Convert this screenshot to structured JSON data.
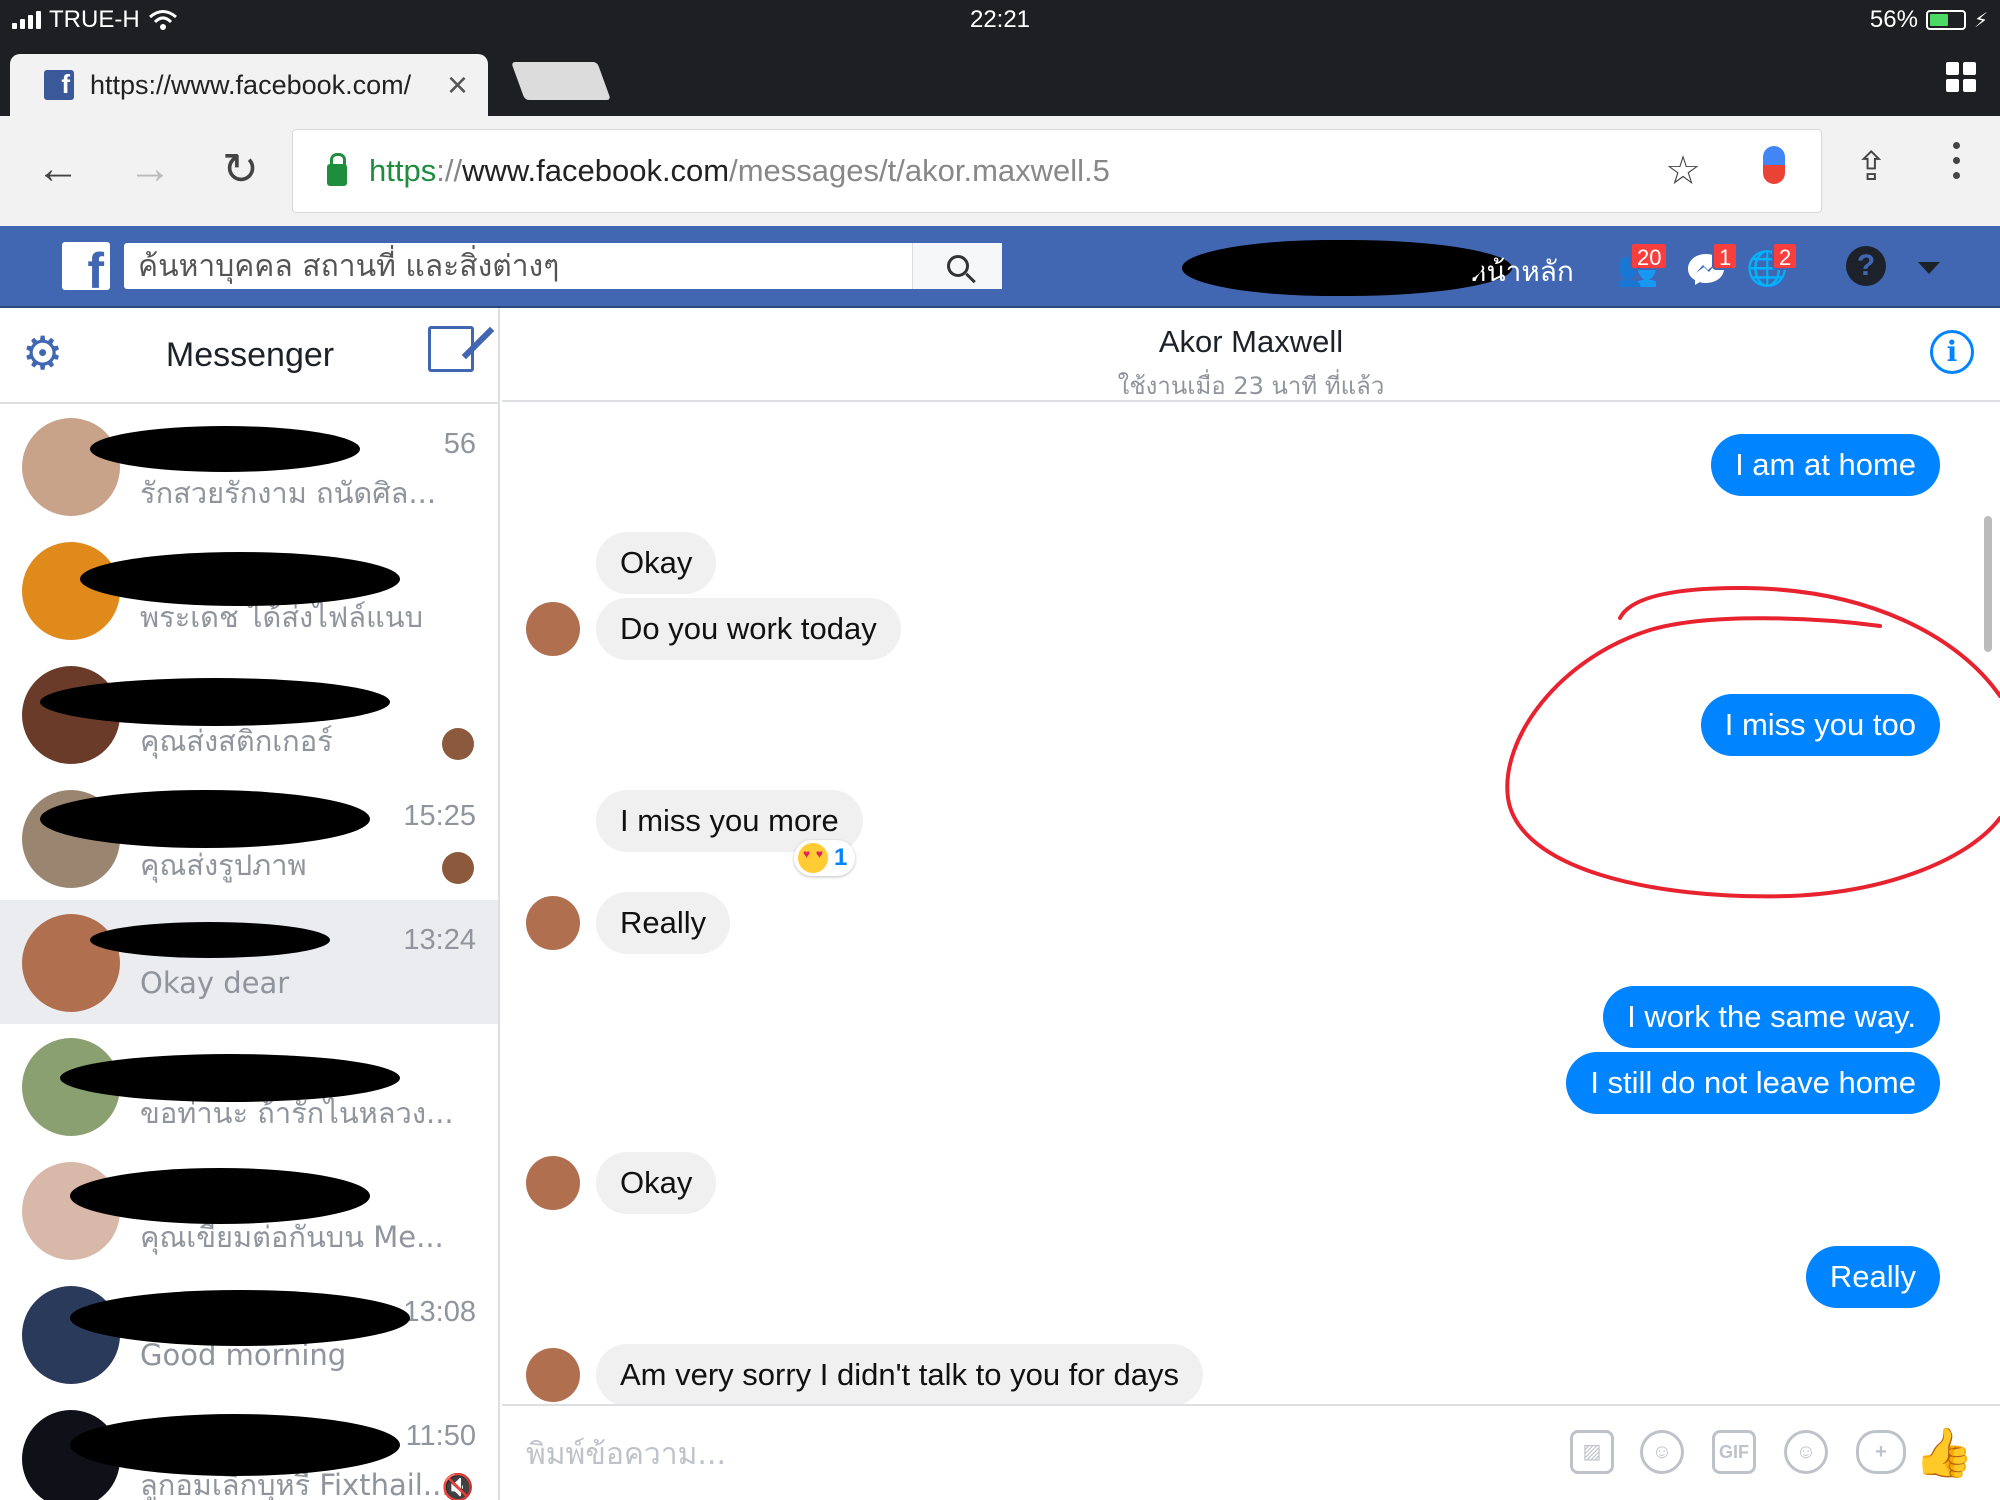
{
  "status_bar": {
    "carrier": "TRUE-H",
    "time": "22:21",
    "battery": "56%",
    "battery_level": 0.56
  },
  "tab": {
    "title": "https://www.facebook.com/",
    "favicon": "facebook-favicon"
  },
  "omnibox": {
    "scheme": "https",
    "sep": "://",
    "host": "www.facebook.com",
    "path": "/messages/t/akor.maxwell.5"
  },
  "fb": {
    "search_placeholder": "ค้นหาบุคคล สถานที่ และสิ่งต่างๆ",
    "home_label": "หน้าหลัก",
    "badges": {
      "friends": "20",
      "messages": "1",
      "notifications": "2"
    },
    "help": "?"
  },
  "sidebar": {
    "title": "Messenger",
    "conversations": [
      {
        "snippet": "รักสวยรักงาม ถนัดศิล...",
        "time": "56",
        "avatar": "#c8a38a"
      },
      {
        "snippet": "พระเดช ได้ส่งไฟล์แนบ",
        "time": "",
        "avatar": "#e08a1c"
      },
      {
        "snippet": "คุณส่งสติกเกอร์",
        "time": "",
        "avatar": "#6b3b2a"
      },
      {
        "snippet": "คุณส่งรูปภาพ",
        "time": "15:25",
        "avatar": "#9a8670"
      },
      {
        "snippet": "Okay dear",
        "time": "13:24",
        "avatar": "#b07050"
      },
      {
        "snippet": "ขอท่านะ ถ้ารักไนหลวง...",
        "time": "",
        "avatar": "#8aa070"
      },
      {
        "snippet": "คุณเขียมต่อกันบน Me...",
        "time": "",
        "avatar": "#d8b8a8"
      },
      {
        "snippet": "Good morning",
        "time": "13:08",
        "avatar": "#2a3a5a"
      },
      {
        "snippet": "ลูกอมเลิกบุหรี่ Fixthail...",
        "time": "11:50",
        "avatar": "#101018"
      }
    ]
  },
  "chat": {
    "name": "Akor Maxwell",
    "status": "ใช้งานเมื่อ 23 นาที ที่แล้ว",
    "messages": [
      {
        "dir": "out",
        "text": "I am at home"
      },
      {
        "dir": "in",
        "text": "Okay"
      },
      {
        "dir": "in",
        "text": "Do you work today"
      },
      {
        "dir": "out",
        "text": "I miss you too"
      },
      {
        "dir": "in",
        "text": "I miss you more"
      },
      {
        "dir": "in",
        "text": "Really"
      },
      {
        "dir": "out",
        "text": "I work the same way."
      },
      {
        "dir": "out",
        "text": "I still do not leave home"
      },
      {
        "dir": "in",
        "text": "Okay"
      },
      {
        "dir": "out",
        "text": "Really"
      },
      {
        "dir": "in",
        "text": "Am very sorry I didn't talk to you for days"
      }
    ],
    "reaction": {
      "emoji": "heart-eyes-emoji",
      "count": "1"
    },
    "composer_placeholder": "พิมพ์ข้อความ...",
    "tools": {
      "gif": "GIF"
    }
  },
  "colors": {
    "fb_blue": "#4267b2",
    "messenger_blue": "#0084ff",
    "annotation_red": "#e8222e"
  }
}
